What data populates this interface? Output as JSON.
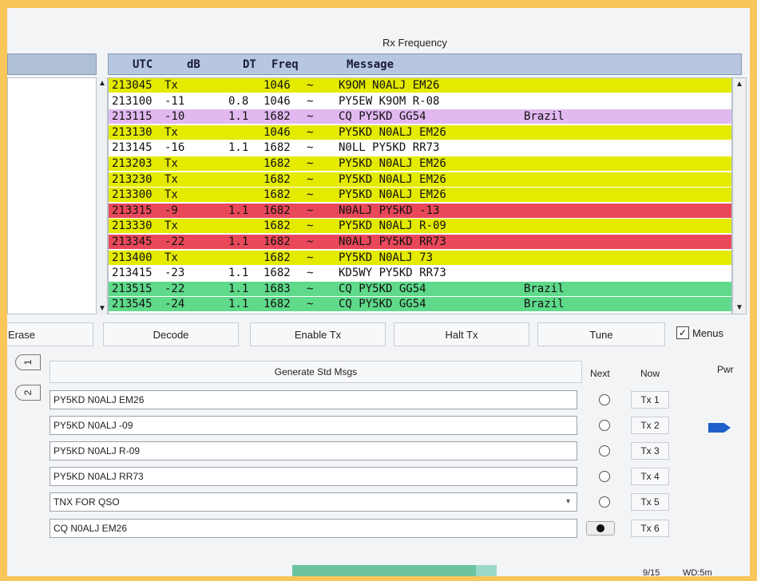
{
  "rx_frequency_label": "Rx Frequency",
  "table": {
    "headers": {
      "utc": "UTC",
      "db": "dB",
      "dt": "DT",
      "freq": "Freq",
      "message": "Message"
    },
    "rows": [
      {
        "utc": "213045",
        "db": "Tx",
        "dt": "",
        "freq": "1046",
        "tilde": "~",
        "message": "K9OM N0ALJ EM26",
        "country": "",
        "color": "#e4ea00"
      },
      {
        "utc": "213100",
        "db": "-11",
        "dt": "0.8",
        "freq": "1046",
        "tilde": "~",
        "message": "PY5EW K9OM R-08",
        "country": "",
        "color": "#ffffff"
      },
      {
        "utc": "213115",
        "db": "-10",
        "dt": "1.1",
        "freq": "1682",
        "tilde": "~",
        "message": "CQ PY5KD GG54",
        "country": "Brazil",
        "color": "#e2b8f0"
      },
      {
        "utc": "213130",
        "db": "Tx",
        "dt": "",
        "freq": "1046",
        "tilde": "~",
        "message": "PY5KD N0ALJ EM26",
        "country": "",
        "color": "#e4ea00"
      },
      {
        "utc": "213145",
        "db": "-16",
        "dt": "1.1",
        "freq": "1682",
        "tilde": "~",
        "message": "N0LL PY5KD RR73",
        "country": "",
        "color": "#ffffff"
      },
      {
        "utc": "213203",
        "db": "Tx",
        "dt": "",
        "freq": "1682",
        "tilde": "~",
        "message": "PY5KD N0ALJ EM26",
        "country": "",
        "color": "#e4ea00"
      },
      {
        "utc": "213230",
        "db": "Tx",
        "dt": "",
        "freq": "1682",
        "tilde": "~",
        "message": "PY5KD N0ALJ EM26",
        "country": "",
        "color": "#e4ea00"
      },
      {
        "utc": "213300",
        "db": "Tx",
        "dt": "",
        "freq": "1682",
        "tilde": "~",
        "message": "PY5KD N0ALJ EM26",
        "country": "",
        "color": "#e4ea00"
      },
      {
        "utc": "213315",
        "db": "-9",
        "dt": "1.1",
        "freq": "1682",
        "tilde": "~",
        "message": "N0ALJ PY5KD -13",
        "country": "",
        "color": "#e8485a"
      },
      {
        "utc": "213330",
        "db": "Tx",
        "dt": "",
        "freq": "1682",
        "tilde": "~",
        "message": "PY5KD N0ALJ R-09",
        "country": "",
        "color": "#e4ea00"
      },
      {
        "utc": "213345",
        "db": "-22",
        "dt": "1.1",
        "freq": "1682",
        "tilde": "~",
        "message": "N0ALJ PY5KD RR73",
        "country": "",
        "color": "#e8485a"
      },
      {
        "utc": "213400",
        "db": "Tx",
        "dt": "",
        "freq": "1682",
        "tilde": "~",
        "message": "PY5KD N0ALJ 73",
        "country": "",
        "color": "#e4ea00"
      },
      {
        "utc": "213415",
        "db": "-23",
        "dt": "1.1",
        "freq": "1682",
        "tilde": "~",
        "message": "KD5WY PY5KD RR73",
        "country": "",
        "color": "#ffffff"
      },
      {
        "utc": "213515",
        "db": "-22",
        "dt": "1.1",
        "freq": "1683",
        "tilde": "~",
        "message": "CQ PY5KD GG54",
        "country": "Brazil",
        "color": "#5fd98a"
      },
      {
        "utc": "213545",
        "db": "-24",
        "dt": "1.1",
        "freq": "1682",
        "tilde": "~",
        "message": "CQ PY5KD GG54",
        "country": "Brazil",
        "color": "#5fd98a"
      }
    ]
  },
  "buttons": {
    "erase": "Erase",
    "decode": "Decode",
    "enable_tx": "Enable Tx",
    "halt_tx": "Halt Tx",
    "tune": "Tune",
    "menus": "Menus",
    "menus_checked": "✓"
  },
  "tabs": {
    "tab1": "1",
    "tab2": "2"
  },
  "generate_label": "Generate Std Msgs",
  "col_next": "Next",
  "col_now": "Now",
  "pwr_label": "Pwr",
  "tx_messages": [
    {
      "text": "PY5KD N0ALJ EM26",
      "tx_label": "Tx 1"
    },
    {
      "text": "PY5KD N0ALJ -09",
      "tx_label": "Tx 2"
    },
    {
      "text": "PY5KD N0ALJ R-09",
      "tx_label": "Tx 3"
    },
    {
      "text": "PY5KD N0ALJ RR73",
      "tx_label": "Tx 4"
    },
    {
      "text": "TNX FOR QSO",
      "tx_label": "Tx 5"
    },
    {
      "text": "CQ N0ALJ EM26",
      "tx_label": "Tx 6"
    }
  ],
  "selected_next_index": 5,
  "status": {
    "slot": "9/15",
    "wd": "WD:5m"
  },
  "progress_fraction": 0.9
}
